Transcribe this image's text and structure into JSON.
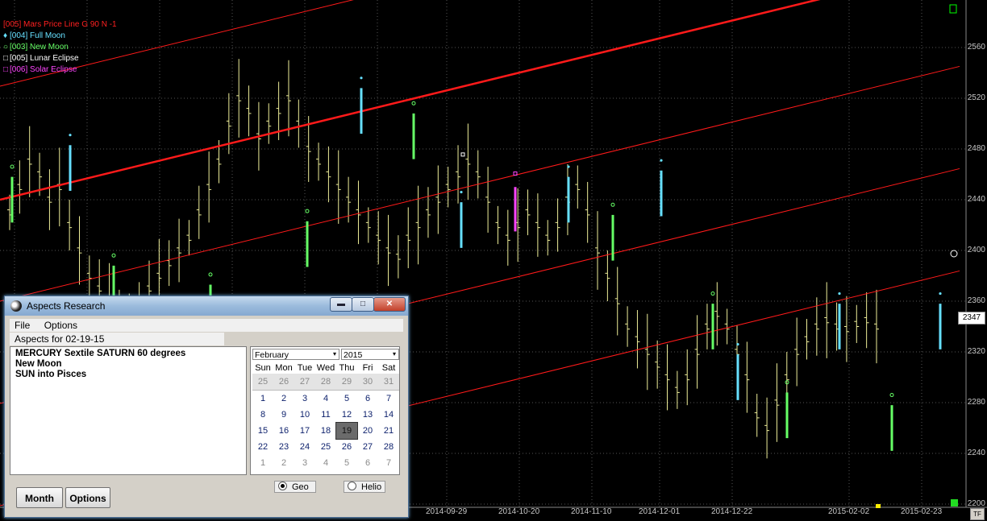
{
  "chart": {
    "legend": [
      {
        "text": "[005] Mars Price Line G 90 N -1",
        "color": "#ff2020",
        "marker": ""
      },
      {
        "text": "[004] Full Moon",
        "color": "#66e0ff",
        "marker": "♦"
      },
      {
        "text": "[003] New Moon",
        "color": "#66ff66",
        "marker": "○"
      },
      {
        "text": "[005] Lunar Eclipse",
        "color": "#ffffff",
        "marker": "□"
      },
      {
        "text": "[006] Solar Eclipse",
        "color": "#ff44ff",
        "marker": "□"
      }
    ],
    "price_levels": [
      "2560",
      "2520",
      "2480",
      "2440",
      "2400",
      "2360",
      "2320",
      "2280",
      "2240",
      "2200"
    ],
    "dates": [
      "2014-09-29",
      "2014-10-20",
      "2014-11-10",
      "2014-12-01",
      "2014-12-22",
      "2015-02-02",
      "2015-02-23"
    ],
    "last_price": "2347",
    "tf_label": "TF",
    "colors": {
      "background": "#000000",
      "bars": "#eeee99",
      "price_line": "#ff1a1a",
      "grid": "#666666"
    }
  },
  "dialog": {
    "title": "Aspects Research",
    "buttons": {
      "minimize": "▬",
      "maximize": "□",
      "close": "✕"
    },
    "menu": [
      "File",
      "Options"
    ],
    "header": "Aspects for 02-19-15",
    "aspects": [
      "MERCURY Sextile SATURN  60 degrees",
      "New Moon",
      "SUN into Pisces"
    ],
    "calendar": {
      "month": "February",
      "year": "2015",
      "weekdays": [
        "Sun",
        "Mon",
        "Tue",
        "Wed",
        "Thu",
        "Fri",
        "Sat"
      ],
      "prev_days": [
        "25",
        "26",
        "27",
        "28",
        "29",
        "30",
        "31"
      ],
      "weeks": [
        [
          "1",
          "2",
          "3",
          "4",
          "5",
          "6",
          "7"
        ],
        [
          "8",
          "9",
          "10",
          "11",
          "12",
          "13",
          "14"
        ],
        [
          "15",
          "16",
          "17",
          "18",
          "19",
          "20",
          "21"
        ],
        [
          "22",
          "23",
          "24",
          "25",
          "26",
          "27",
          "28"
        ]
      ],
      "next_days": [
        "1",
        "2",
        "3",
        "4",
        "5",
        "6",
        "7"
      ],
      "selected": "19"
    },
    "radio": {
      "geo": "Geo",
      "helio": "Helio",
      "selected": "geo"
    },
    "month_button": "Month",
    "options_button": "Options"
  }
}
